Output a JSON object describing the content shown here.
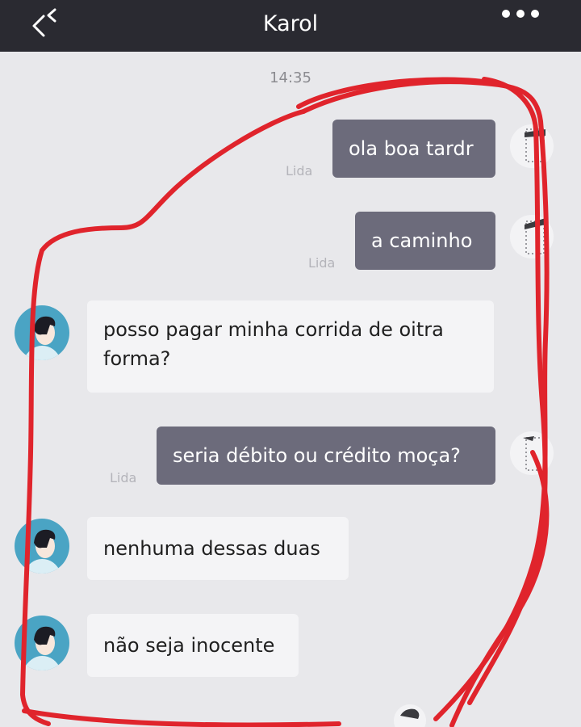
{
  "header": {
    "title": "Karol",
    "back_icon": "double-chevron-left-icon",
    "more_icon": "more-dots-icon"
  },
  "chat": {
    "timestamp": "14:35",
    "messages": [
      {
        "direction": "outgoing",
        "text": "ola boa tardr",
        "status": "Lida"
      },
      {
        "direction": "outgoing",
        "text": "a caminho",
        "status": "Lida"
      },
      {
        "direction": "incoming",
        "text": "posso pagar minha corrida de oitra forma?"
      },
      {
        "direction": "outgoing",
        "text": "seria débito ou crédito moça?",
        "status": "Lida"
      },
      {
        "direction": "incoming",
        "text": "nenhuma dessas duas"
      },
      {
        "direction": "incoming",
        "text": "não seja inocente"
      }
    ]
  },
  "colors": {
    "header_bg": "#2a2a31",
    "outgoing_bubble": "#6c6b7b",
    "incoming_bubble": "#f4f4f6",
    "chat_bg": "#e8e8eb",
    "avatar_bg": "#4aa4c4",
    "annotation": "#e0242c"
  }
}
